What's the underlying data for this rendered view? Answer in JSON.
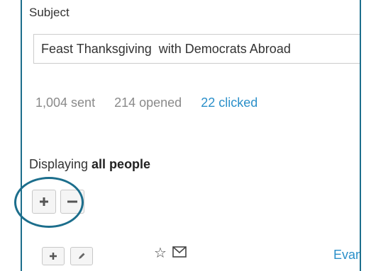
{
  "subject": {
    "label": "Subject",
    "value": "Feast Thanksgiving  with Democrats Abroad"
  },
  "stats": {
    "sent": "1,004 sent",
    "opened": "214 opened",
    "clicked": "22 clicked"
  },
  "people_filter": {
    "prefix": "Displaying ",
    "value": "all people"
  },
  "event_link": "Evant",
  "colors": {
    "border_accent": "#1c6e8c",
    "link": "#2a8fc9"
  },
  "icons": [
    "plus-icon",
    "minus-icon",
    "pencil-icon",
    "star-icon",
    "mail-icon"
  ]
}
